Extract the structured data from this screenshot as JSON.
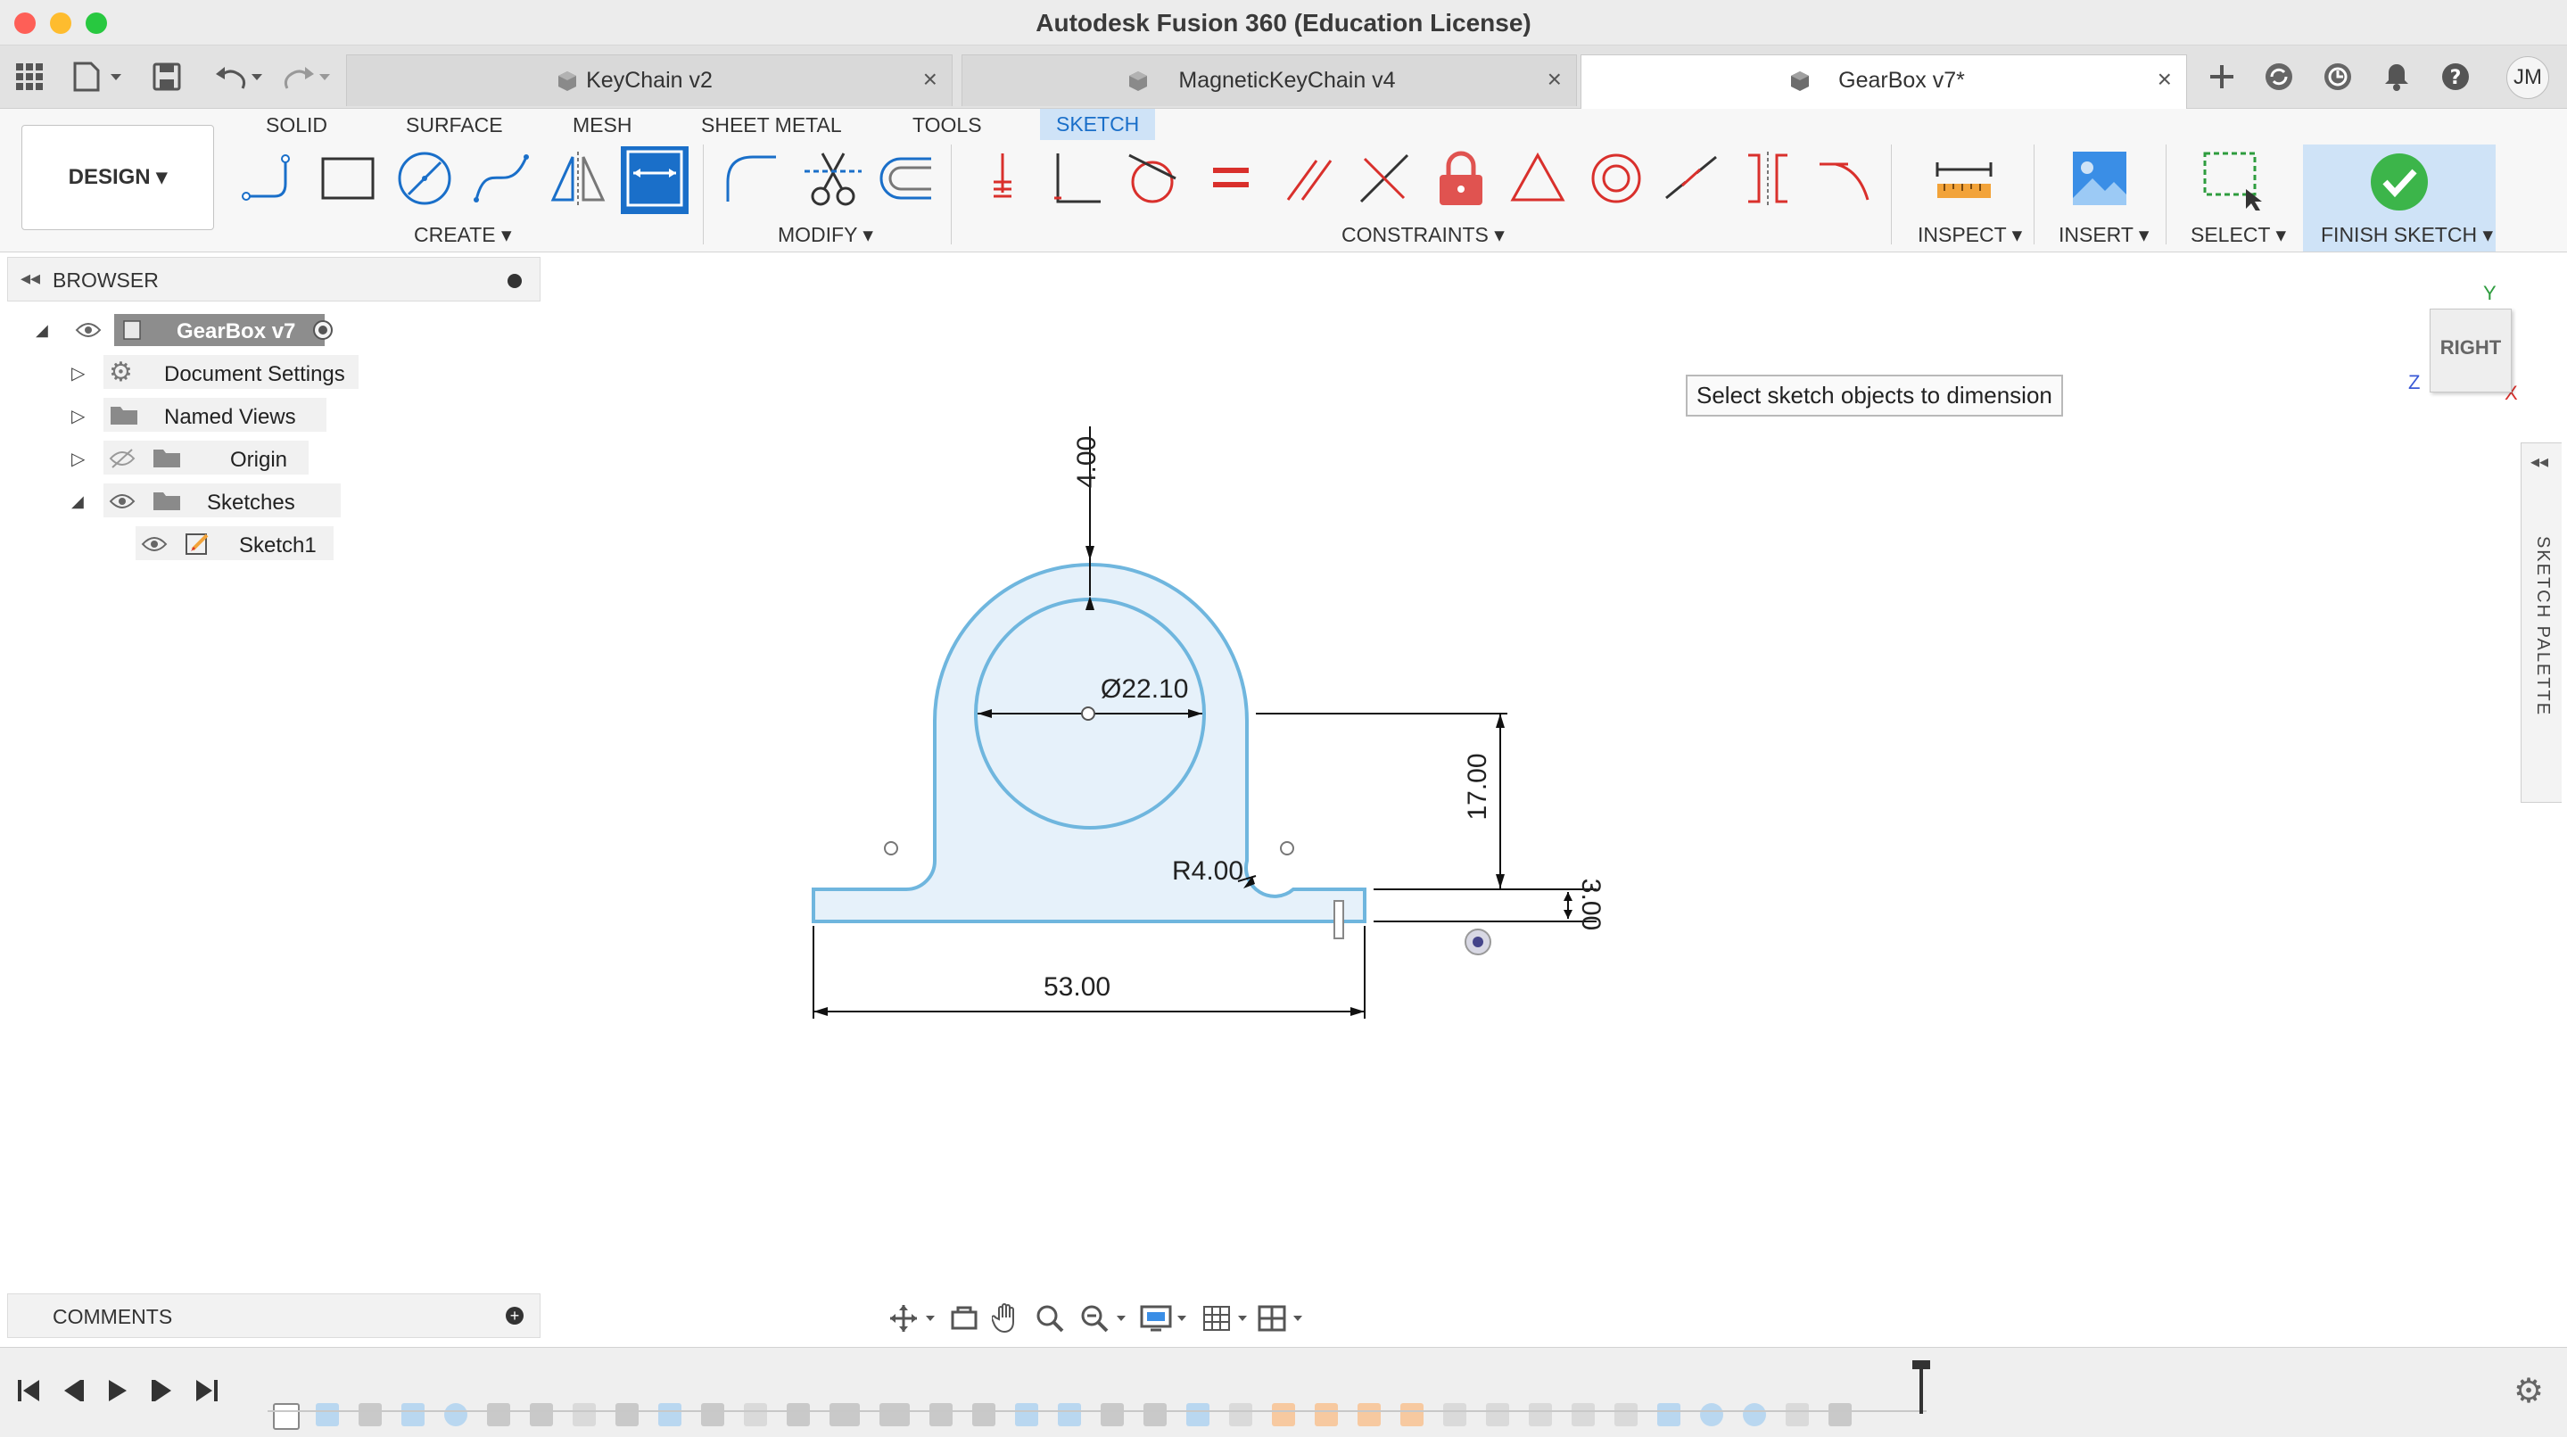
{
  "window": {
    "title": "Autodesk Fusion 360 (Education License)"
  },
  "tabs": [
    {
      "label": "KeyChain v2",
      "active": false
    },
    {
      "label": "MagneticKeyChain v4",
      "active": false
    },
    {
      "label": "GearBox v7*",
      "active": true
    }
  ],
  "user": {
    "initials": "JM"
  },
  "ribbon": {
    "workspace": "DESIGN ▾",
    "tabs": [
      "SOLID",
      "SURFACE",
      "MESH",
      "SHEET METAL",
      "TOOLS",
      "SKETCH"
    ],
    "active_tab": "SKETCH",
    "groups": {
      "create": "CREATE ▾",
      "modify": "MODIFY ▾",
      "constraints": "CONSTRAINTS ▾",
      "inspect": "INSPECT ▾",
      "insert": "INSERT ▾",
      "select": "SELECT ▾",
      "finish": "FINISH SKETCH ▾"
    },
    "accent": "#1a6fc9"
  },
  "browser": {
    "title": "BROWSER",
    "items": [
      {
        "label": "GearBox v7"
      },
      {
        "label": "Document Settings"
      },
      {
        "label": "Named Views"
      },
      {
        "label": "Origin"
      },
      {
        "label": "Sketches"
      },
      {
        "label": "Sketch1"
      }
    ]
  },
  "comments": {
    "title": "COMMENTS"
  },
  "tooltip": {
    "text": "Select sketch objects to dimension"
  },
  "viewcube": {
    "face": "RIGHT",
    "axis_y": "Y",
    "axis_z": "Z",
    "axis_x": "X"
  },
  "palette": {
    "label": "SKETCH PALETTE"
  },
  "sketch": {
    "dim_top": "4.00",
    "dim_diameter": "Ø22.10",
    "dim_height": "17.00",
    "dim_radius": "R4.00",
    "dim_thickness": "3.00",
    "dim_width": "53.00",
    "profile_fill": "#e6f1fa",
    "line_color": "#6fb6de"
  }
}
